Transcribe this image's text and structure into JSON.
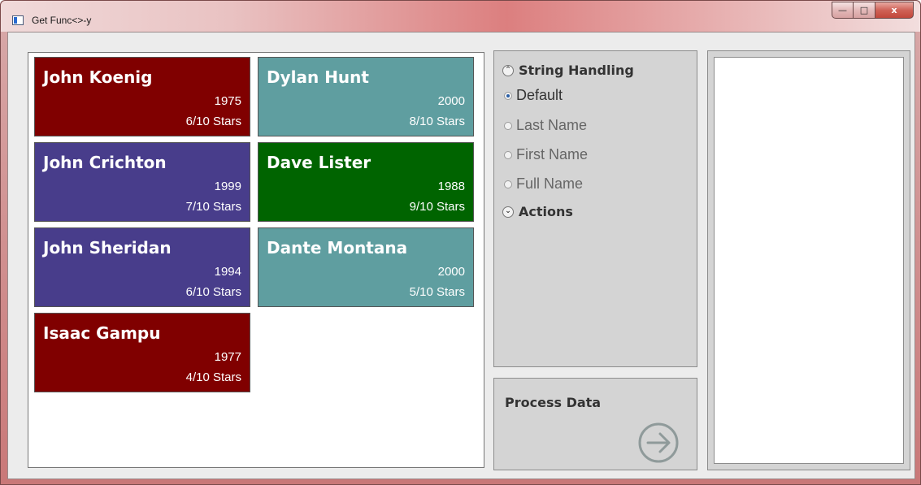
{
  "window": {
    "title": "Get Func<>-y",
    "minimize_glyph": "—",
    "maximize_glyph": "□",
    "close_glyph": "x"
  },
  "colors": {
    "maroon": "#800000",
    "teal": "#5f9ea0",
    "slate_blue": "#483d8b",
    "green": "#006400"
  },
  "cards": [
    {
      "name": "John Koenig",
      "year": "1975",
      "stars": "6/10 Stars",
      "color": "#800000"
    },
    {
      "name": "Dylan Hunt",
      "year": "2000",
      "stars": "8/10 Stars",
      "color": "#5f9ea0"
    },
    {
      "name": "John Crichton",
      "year": "1999",
      "stars": "7/10 Stars",
      "color": "#483d8b"
    },
    {
      "name": "Dave Lister",
      "year": "1988",
      "stars": "9/10 Stars",
      "color": "#006400"
    },
    {
      "name": "John Sheridan",
      "year": "1994",
      "stars": "6/10 Stars",
      "color": "#483d8b"
    },
    {
      "name": "Dante Montana",
      "year": "2000",
      "stars": "5/10 Stars",
      "color": "#5f9ea0"
    },
    {
      "name": "Isaac Gampu",
      "year": "1977",
      "stars": "4/10 Stars",
      "color": "#800000"
    }
  ],
  "string_handling": {
    "header": "String Handling",
    "expander_icon": "chevron-up-icon",
    "selected": "Default",
    "options": [
      "Default",
      "Last Name",
      "First Name",
      "Full Name"
    ]
  },
  "actions": {
    "header": "Actions",
    "expander_icon": "chevron-down-icon"
  },
  "process": {
    "label": "Process Data",
    "icon": "arrow-right-circle-icon"
  }
}
